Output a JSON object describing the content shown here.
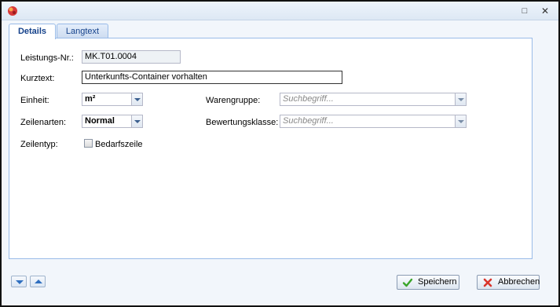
{
  "window": {
    "title": ""
  },
  "tabs": [
    {
      "label": "Details",
      "active": true
    },
    {
      "label": "Langtext",
      "active": false
    }
  ],
  "form": {
    "leistungsnr": {
      "label": "Leistungs-Nr.:",
      "value": "MK.T01.0004"
    },
    "kurztext": {
      "label": "Kurztext:",
      "value": "Unterkunfts-Container vorhalten"
    },
    "einheit": {
      "label": "Einheit:",
      "value": "m²"
    },
    "zeilenarten": {
      "label": "Zeilenarten:",
      "value": "Normal"
    },
    "zeilentyp": {
      "label": "Zeilentyp:",
      "checkbox_label": "Bedarfszeile",
      "checked": false
    },
    "warengruppe": {
      "label": "Warengruppe:",
      "placeholder": "Suchbegriff..."
    },
    "bewertungsklasse": {
      "label": "Bewertungsklasse:",
      "placeholder": "Suchbegriff..."
    }
  },
  "buttons": {
    "save": "Speichern",
    "cancel": "Abbrechen"
  },
  "colors": {
    "accent": "#15428b",
    "border": "#99bbe8",
    "save_icon": "#3aa52a",
    "cancel_icon": "#d9342b"
  }
}
